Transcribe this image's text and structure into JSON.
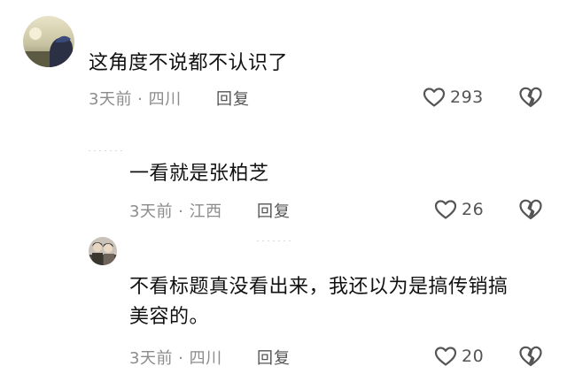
{
  "comments": [
    {
      "text": "这角度不说都不认识了",
      "meta": "3天前 · 四川",
      "reply_label": "回复",
      "likes": "293"
    },
    {
      "text": "一看就是张柏芝",
      "meta": "3天前 · 江西",
      "reply_label": "回复",
      "likes": "26"
    },
    {
      "text_line1": "不看标题真没看出来，我还以为是搞传销搞",
      "text_line2": "美容的。",
      "meta": "3天前 · 四川",
      "reply_label": "回复",
      "likes": "20"
    }
  ],
  "icons": {
    "like": "heart-outline-icon",
    "dislike": "broken-heart-outline-icon"
  },
  "colors": {
    "text": "#111111",
    "meta": "#8c8c8c",
    "icon": "#555555"
  }
}
